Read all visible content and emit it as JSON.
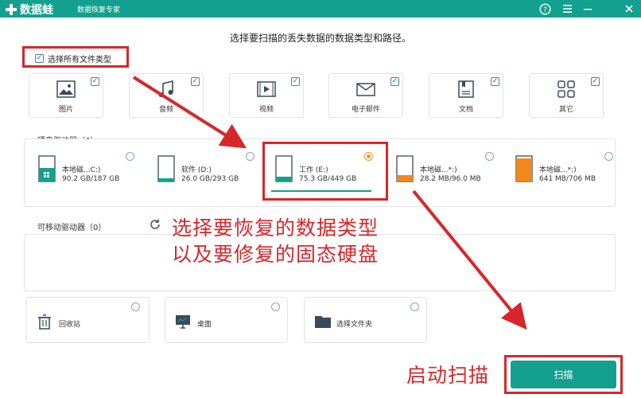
{
  "app": {
    "logo_text": "数据蛙",
    "subtitle": "数据恢复专家",
    "help_icon": "help-icon",
    "menu_icon": "menu-icon",
    "minimize_icon": "minimize-icon",
    "close_icon": "close-icon"
  },
  "instruction": "选择要扫描的丢失数据的数据类型和路径。",
  "select_all": {
    "label": "选择所有文件类型",
    "checked": true
  },
  "file_types": [
    {
      "label": "图片",
      "icon": "image-icon",
      "checked": true
    },
    {
      "label": "音频",
      "icon": "music-icon",
      "checked": true
    },
    {
      "label": "视频",
      "icon": "video-icon",
      "checked": true
    },
    {
      "label": "电子邮件",
      "icon": "email-icon",
      "checked": true
    },
    {
      "label": "文档",
      "icon": "document-icon",
      "checked": true
    },
    {
      "label": "其它",
      "icon": "others-icon",
      "checked": true
    }
  ],
  "disk_section": {
    "label": "硬盘驱动器（6）",
    "drives": [
      {
        "name": "本地磁...C:)",
        "size": "90.2 GB/187 GB",
        "selected": false,
        "color": "#14a08e"
      },
      {
        "name": "软件 (D:)",
        "size": "26.0 GB/293 GB",
        "selected": false,
        "color": "#14a08e"
      },
      {
        "name": "工作 (E:)",
        "size": "75.3 GB/449 GB",
        "selected": true,
        "color": "#14a08e"
      },
      {
        "name": "本地磁...*:)",
        "size": "28.2 MB/96.0 MB",
        "selected": false,
        "color": "#f08a1c"
      },
      {
        "name": "本地磁...*:)",
        "size": "641 MB/706 MB",
        "selected": false,
        "color": "#f08a1c"
      }
    ]
  },
  "removable_section": {
    "label": "可移动驱动器（0）",
    "refresh_icon": "refresh-icon"
  },
  "locations": [
    {
      "label": "回收站",
      "icon": "trash-icon"
    },
    {
      "label": "桌面",
      "icon": "desktop-icon"
    },
    {
      "label": "选择文件夹",
      "icon": "folder-icon"
    }
  ],
  "annotations": {
    "line1": "选择要恢复的数据类型",
    "line2": "以及要修复的固态硬盘",
    "start_scan": "启动扫描"
  },
  "scan_button": {
    "label": "扫描"
  },
  "colors": {
    "brand": "#14a08e",
    "highlight": "#d9262a",
    "selected_radio": "#e89b1d"
  }
}
